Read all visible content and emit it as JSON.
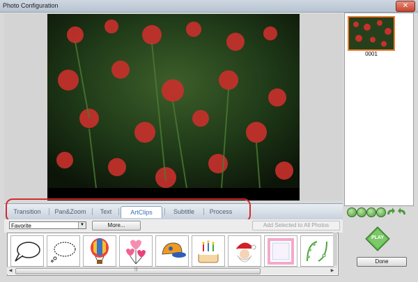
{
  "window": {
    "title": "Photo Configuration",
    "close_glyph": "✕"
  },
  "photo": {
    "thumbnail_label": "0001"
  },
  "tabs": [
    {
      "label": "Transition",
      "active": false
    },
    {
      "label": "Pan&Zoom",
      "active": false
    },
    {
      "label": "Text",
      "active": false
    },
    {
      "label": "ArtClips",
      "active": true
    },
    {
      "label": "Subtitle",
      "active": false
    },
    {
      "label": "Process",
      "active": false
    }
  ],
  "clip_controls": {
    "category_selected": "Favorite",
    "more_label": "More...",
    "add_all_label": "Add Selected to All Photos"
  },
  "clips": [
    {
      "icon": "speech-bubble-icon"
    },
    {
      "icon": "thought-bubble-icon"
    },
    {
      "icon": "hot-air-balloon-icon"
    },
    {
      "icon": "heart-balloons-icon"
    },
    {
      "icon": "cap-icon"
    },
    {
      "icon": "birthday-cake-icon"
    },
    {
      "icon": "santa-claus-icon"
    },
    {
      "icon": "pink-frame-icon"
    },
    {
      "icon": "floral-frame-icon"
    }
  ],
  "actions": {
    "play_label": "PLAY",
    "done_label": "Done",
    "scroll_grip": "|||"
  },
  "colors": {
    "accent": "#3a6fb4",
    "annotation": "#d42b2b",
    "thumb_border": "#f07a2a"
  }
}
